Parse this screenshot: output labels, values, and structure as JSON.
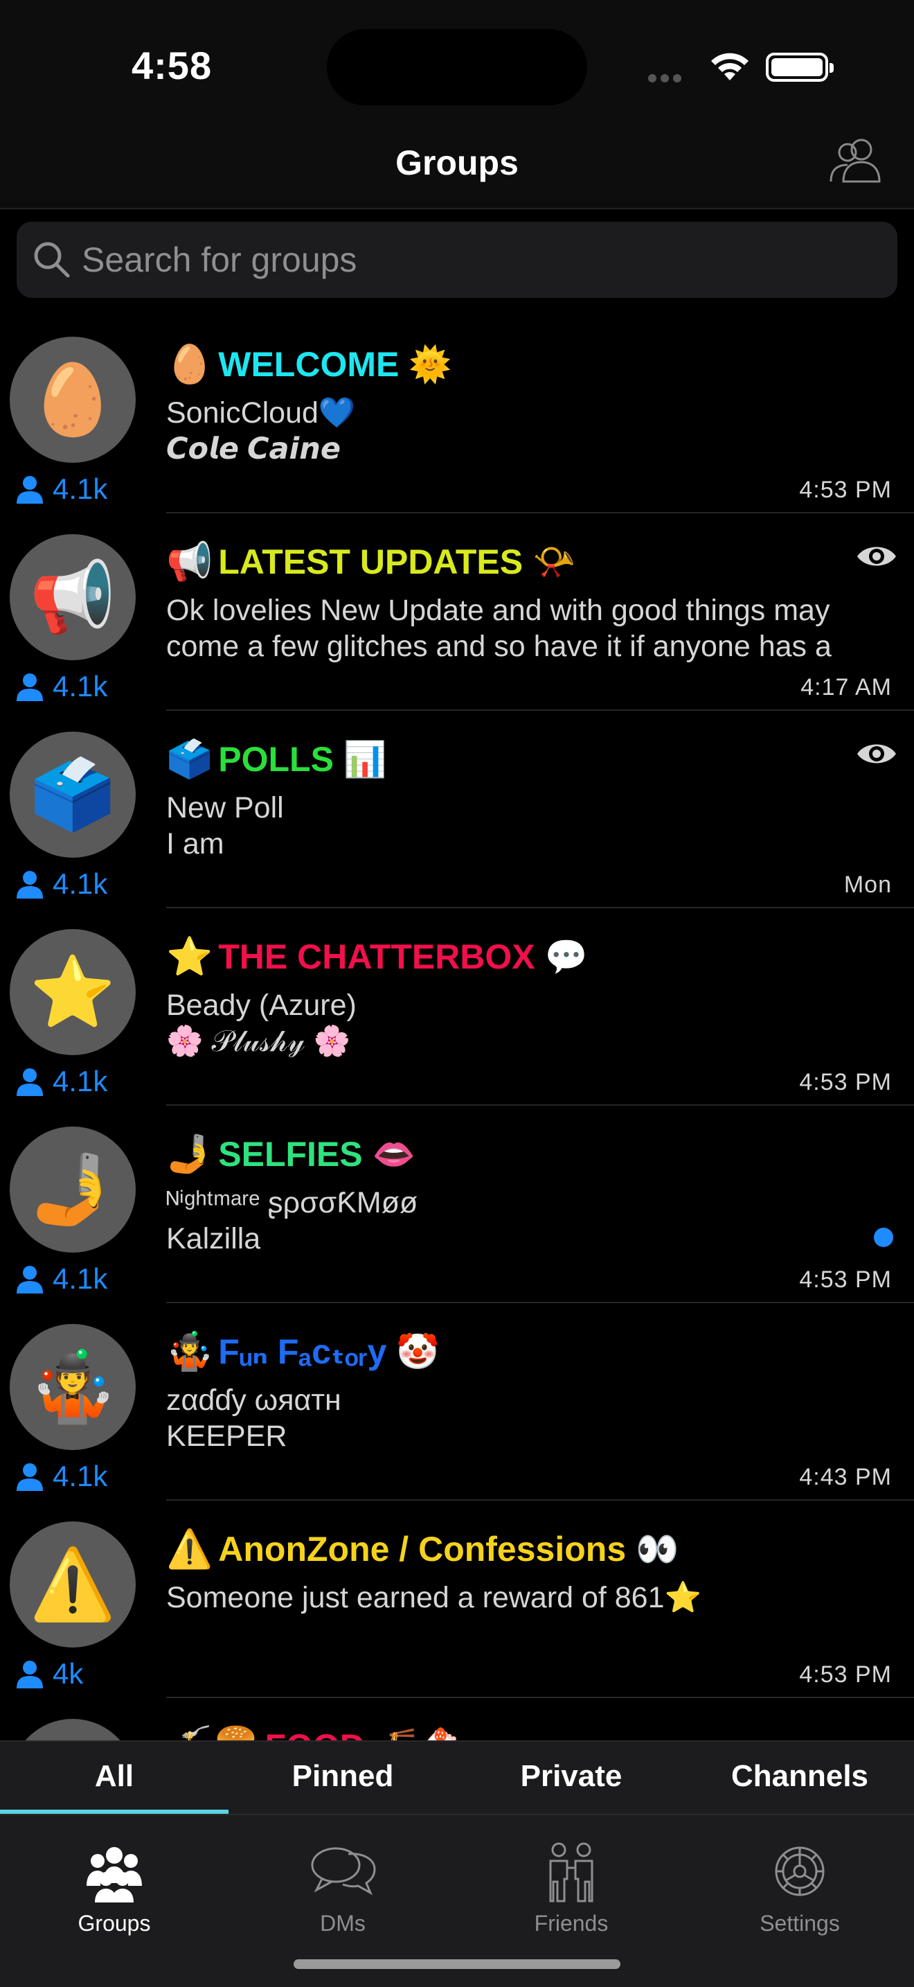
{
  "status_bar": {
    "time": "4:58"
  },
  "header": {
    "title": "Groups"
  },
  "search": {
    "placeholder": "Search for groups"
  },
  "groups": [
    {
      "avatar": "🥚",
      "title_prefix": "🥚",
      "title": "WELCOME",
      "title_suffix": "🌞",
      "title_color": "#1ee6f0",
      "members": "4.1k",
      "preview_line1": "SonicCloud💙",
      "preview_line2": "𝘾𝙤𝙡𝙚 𝘾𝙖𝙞𝙣𝙚",
      "timestamp": "4:53 PM",
      "watching": false,
      "unread": false
    },
    {
      "avatar": "📢",
      "title_prefix": "📢",
      "title": "LATEST UPDATES",
      "title_suffix": "📯",
      "title_color": "#d8ea1c",
      "members": "4.1k",
      "preview_line1": "Ok lovelies New Update and with good things may",
      "preview_line2": "come a few glitches and so have it if anyone has a",
      "timestamp": "4:17 AM",
      "watching": true,
      "unread": false
    },
    {
      "avatar": "🗳️",
      "title_prefix": "🗳️",
      "title": "POLLS",
      "title_suffix": "📊",
      "title_color": "#2adf3b",
      "members": "4.1k",
      "preview_line1": "New Poll",
      "preview_line2": "I am",
      "timestamp": "Mon",
      "watching": true,
      "unread": false
    },
    {
      "avatar": "⭐",
      "title_prefix": "⭐",
      "title": "THE CHATTERBOX",
      "title_suffix": "💬",
      "title_color": "#f0104a",
      "members": "4.1k",
      "preview_line1": "Beady (Azure)",
      "preview_line2": "🌸 𝒫𝓁𝓊𝓈𝒽𝓎 🌸",
      "timestamp": "4:53 PM",
      "watching": false,
      "unread": false
    },
    {
      "avatar": "🤳",
      "title_prefix": "🤳",
      "title": "SELFIES",
      "title_suffix": "👄",
      "title_color": "#2ee37f",
      "members": "4.1k",
      "preview_line1": "ᴺⁱᵍʰᵗᵐᵃʳᵉ ʂρσσƘMøø",
      "preview_line2": "Kalzilla",
      "timestamp": "4:53 PM",
      "watching": false,
      "unread": true
    },
    {
      "avatar": "🤹",
      "title_prefix": "🤹",
      "title": "Fᵤₙ Fₐcₜₒᵣy",
      "title_suffix": "🤡",
      "title_color": "#1e6cf5",
      "members": "4.1k",
      "preview_line1": "zαɗɗy ωяαтн",
      "preview_line2": "KEEPER",
      "timestamp": "4:43 PM",
      "watching": false,
      "unread": false
    },
    {
      "avatar": "⚠️",
      "title_prefix": "⚠️",
      "title": "AnonZone / Confessions",
      "title_suffix": "👀",
      "title_color": "#f5d21c",
      "members": "4k",
      "preview_line1": "Someone just earned a reward of 861⭐",
      "preview_line2": "",
      "timestamp": "4:53 PM",
      "watching": false,
      "unread": false
    },
    {
      "avatar": "🍔",
      "title_prefix": "🍝🍔",
      "title": "FOOD",
      "title_suffix": "🍜🍰",
      "title_color": "#f0104a",
      "members": "",
      "preview_line1": "",
      "preview_line2": "",
      "timestamp": "",
      "watching": false,
      "unread": false
    }
  ],
  "filter_tabs": [
    "All",
    "Pinned",
    "Private",
    "Channels"
  ],
  "filter_active": "All",
  "bottom_nav": [
    {
      "label": "Groups",
      "icon": "groups-icon",
      "active": true
    },
    {
      "label": "DMs",
      "icon": "chat-bubbles-icon",
      "active": false
    },
    {
      "label": "Friends",
      "icon": "friends-icon",
      "active": false
    },
    {
      "label": "Settings",
      "icon": "gear-icon",
      "active": false
    }
  ],
  "colors": {
    "accent_blue": "#1e8bff",
    "tab_underline": "#5ad4e6",
    "inactive": "#8e8e93"
  }
}
